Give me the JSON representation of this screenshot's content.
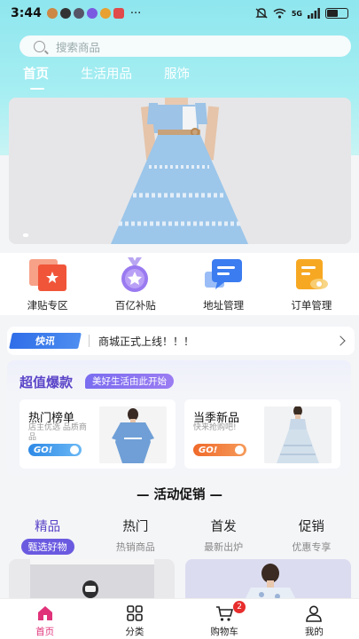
{
  "status_bar": {
    "time": "3:44",
    "more": "···",
    "signal_text": "5G",
    "battery_level": 0.6
  },
  "search": {
    "placeholder": "搜索商品"
  },
  "tabs": [
    {
      "label": "首页",
      "active": true
    },
    {
      "label": "生活用品",
      "active": false
    },
    {
      "label": "服饰",
      "active": false
    }
  ],
  "entries": [
    {
      "label": "津贴专区",
      "icon": "coupon-icon",
      "color": "#f06a4a"
    },
    {
      "label": "百亿补贴",
      "icon": "medal-icon",
      "color": "#8a6ae8"
    },
    {
      "label": "地址管理",
      "icon": "chat-icon",
      "color": "#3b7cf0"
    },
    {
      "label": "订单管理",
      "icon": "order-icon",
      "color": "#f7a823"
    }
  ],
  "notice": {
    "tag": "快讯",
    "text": "商城正式上线！！！"
  },
  "deals": {
    "title": "超值爆款",
    "subtitle": "美好生活由此开始",
    "left": {
      "title": "热门榜单",
      "desc": "店主优选 品质商品",
      "button": "GO!"
    },
    "right": {
      "title": "当季新品",
      "desc": "快来抢购吧!",
      "button": "GO!"
    }
  },
  "section_title": "— 活动促销 —",
  "promo_tabs": [
    {
      "title": "精品",
      "sub": "甄选好物",
      "active": true
    },
    {
      "title": "热门",
      "sub": "热销商品",
      "active": false
    },
    {
      "title": "首发",
      "sub": "最新出炉",
      "active": false
    },
    {
      "title": "促销",
      "sub": "优惠专享",
      "active": false
    }
  ],
  "bottom_nav": [
    {
      "label": "首页",
      "icon": "home-icon",
      "active": true
    },
    {
      "label": "分类",
      "icon": "grid-icon",
      "active": false
    },
    {
      "label": "购物车",
      "icon": "cart-icon",
      "active": false,
      "badge": "2"
    },
    {
      "label": "我的",
      "icon": "profile-icon",
      "active": false
    }
  ],
  "colors": {
    "accent": "#5a44c8",
    "nav_active": "#e0337a",
    "header_bg": "#9be9f0"
  }
}
